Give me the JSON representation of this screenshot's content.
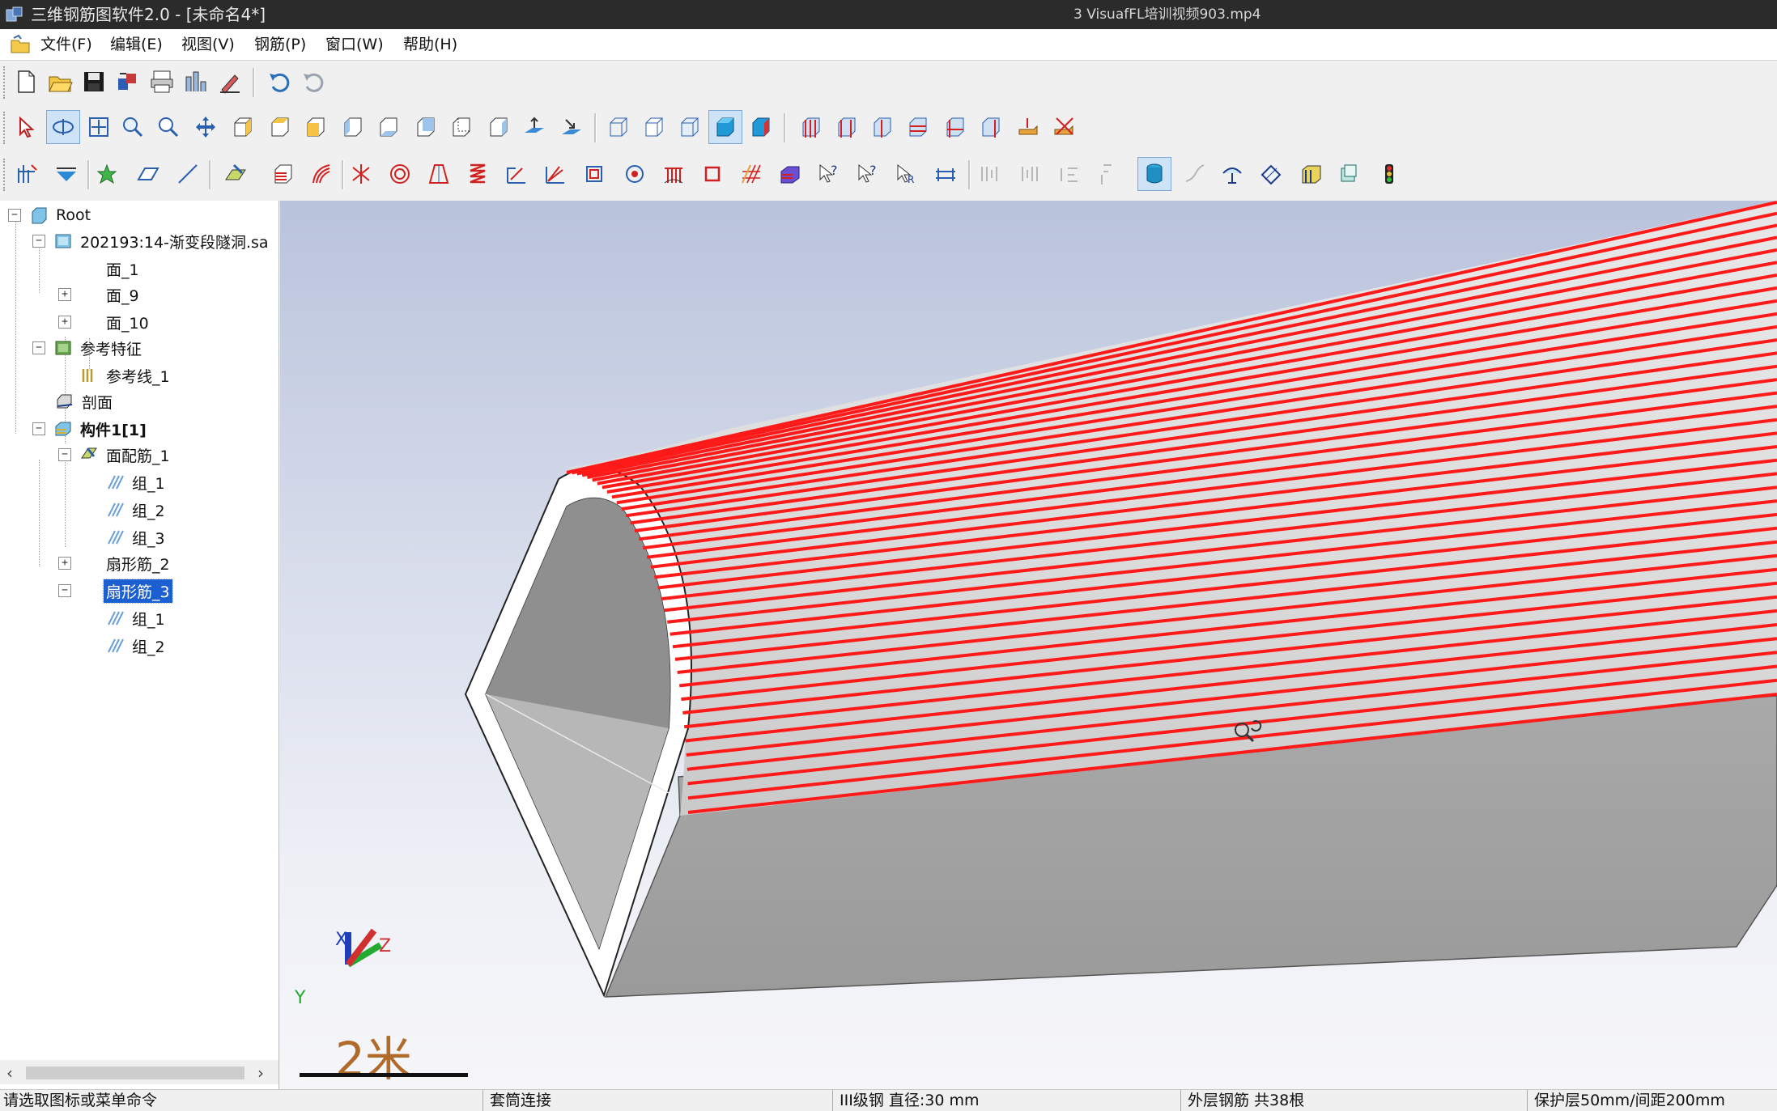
{
  "window": {
    "title": "三维钢筋图软件2.0 - [未命名4*]",
    "video_overlay": "3 VisuafFL培训视频903.mp4"
  },
  "menu": [
    "文件(F)",
    "编辑(E)",
    "视图(V)",
    "钢筋(P)",
    "窗口(W)",
    "帮助(H)"
  ],
  "toolbars": {
    "file": [
      "new-icon",
      "open-icon",
      "save-icon",
      "import-icon",
      "print-icon",
      "export-icon",
      "edit-icon",
      "undo-icon",
      "redo-icon"
    ],
    "view": [
      "select-icon",
      "rotate-icon",
      "zoom-extents-icon",
      "zoom-window-icon",
      "zoom-icon",
      "pan-icon",
      "view-iso-1-icon",
      "view-iso-2-icon",
      "view-iso-3-icon",
      "view-iso-4-icon",
      "view-iso-5-icon",
      "view-iso-6-icon",
      "view-iso-7-icon",
      "view-iso-8-icon",
      "view-plane-1-icon",
      "view-plane-2-icon",
      "wireframe-icon",
      "hidden-line-icon",
      "shaded-edge-icon",
      "shaded-icon",
      "shaded-color-icon",
      "rebar-view-1-icon",
      "rebar-view-2-icon",
      "rebar-view-3-icon",
      "rebar-view-4-icon",
      "rebar-view-5-icon",
      "rebar-view-6-icon",
      "rebar-hand-icon",
      "rebar-hide-icon"
    ],
    "rebar": [
      "component-icon",
      "plane-icon",
      "point-icon",
      "face-icon",
      "line-icon",
      "face-rebar-icon",
      "layer-rebar-icon",
      "fan-rebar-icon",
      "radial-rebar-icon",
      "ring-rebar-icon",
      "trapezoid-rebar-icon",
      "spring-rebar-icon",
      "bend-rebar-icon",
      "angle-rebar-icon",
      "stirrup-icon",
      "circle-rebar-icon",
      "comb-rebar-icon",
      "square-rebar-icon",
      "mesh-rebar-icon",
      "solid-rebar-icon",
      "query-icon",
      "query-2-icon",
      "query-3-icon",
      "dimension-icon",
      "align-1-icon",
      "align-2-icon",
      "align-3-icon",
      "align-4-icon",
      "cylinder-icon",
      "curve-icon",
      "anchor-icon",
      "cut-icon",
      "stack-icon",
      "panel-icon",
      "traffic-light-icon"
    ]
  },
  "tree": {
    "root": "Root",
    "file": "202193:14-渐变段隧洞.sa",
    "faces": [
      "面_1",
      "面_9",
      "面_10"
    ],
    "ref_feature": "参考特征",
    "ref_line": "参考线_1",
    "section": "剖面",
    "component": "构件1[1]",
    "face_rebar": "面配筋_1",
    "face_rebar_groups": [
      "组_1",
      "组_2",
      "组_3"
    ],
    "fan_rebar_2": "扇形筋_2",
    "fan_rebar_3": "扇形筋_3",
    "fan_rebar_3_groups": [
      "组_1",
      "组_2"
    ]
  },
  "viewport": {
    "scale_label": "2米",
    "axes": [
      "X",
      "Y",
      "Z"
    ],
    "rebar_color": "#ff1a1a",
    "rebar_count": 38
  },
  "status": {
    "prompt": "请选取图标或菜单命令",
    "connection": "套筒连接",
    "steel": "III级钢  直径:30 mm",
    "count": "外层钢筋 共38根",
    "cover": "保护层50mm/间距200mm"
  }
}
